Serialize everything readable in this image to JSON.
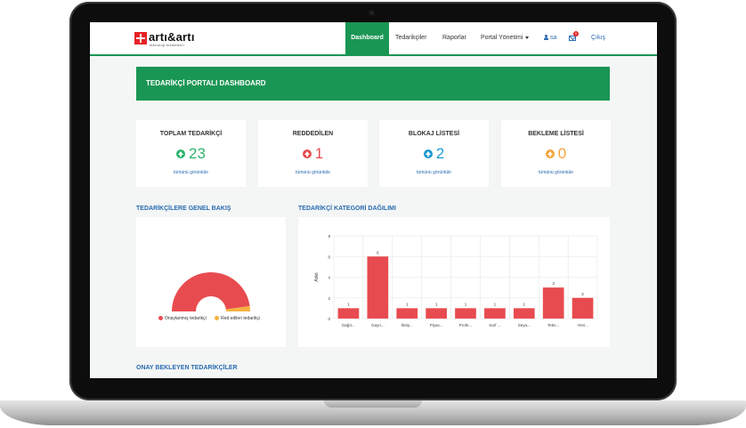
{
  "nav": {
    "brand": "artı&artı",
    "brand_sub": "teknoloji hizmetleri",
    "items": [
      {
        "label": "Dashboard",
        "active": true
      },
      {
        "label": "Tedarikçiler"
      },
      {
        "label": "Raporlar"
      },
      {
        "label": "Portal Yönetimi"
      }
    ],
    "user": "sa",
    "notification_count": "5",
    "logout": "Çıkış"
  },
  "banner": {
    "title": "TEDARİKÇİ PORTALI DASHBOARD"
  },
  "stats": [
    {
      "label": "TOPLAM TEDARİKÇİ",
      "value": "23",
      "link": "tümünü görüntüle",
      "color": "#2db46b"
    },
    {
      "label": "REDDEDİLEN",
      "value": "1",
      "link": "tümünü görüntüle",
      "color": "#e84b4f"
    },
    {
      "label": "BLOKAJ LİSTESİ",
      "value": "2",
      "link": "tümünü görüntüle",
      "color": "#1a9bd0"
    },
    {
      "label": "BEKLEME LİSTESİ",
      "value": "0",
      "link": "tümünü görüntüle",
      "color": "#f4a43a"
    }
  ],
  "overview": {
    "title": "TEDARİKÇİLERE GENEL BAKIŞ",
    "legend": [
      {
        "label": "Onaylanmış tedarikçi",
        "color": "#e84b4f"
      },
      {
        "label": "Red edilen tedarikçi",
        "color": "#f7b13f"
      }
    ]
  },
  "category": {
    "title": "TEDARİKÇİ KATEGORİ DAĞILIMI"
  },
  "pending": {
    "title": "ONAY BEKLEYEN TEDARİKÇİLER"
  },
  "chart_data": [
    {
      "type": "pie",
      "title": "",
      "labels": [
        "Onaylanmış tedarikçi",
        "Red edilen tedarikçi"
      ],
      "values": [
        22,
        1
      ],
      "colors": [
        "#e84b4f",
        "#f7b13f"
      ]
    },
    {
      "type": "bar",
      "title": "",
      "ylabel": "Adet",
      "xlabel": "",
      "ylim": [
        0,
        8
      ],
      "yticks": [
        0,
        2,
        4,
        6,
        8
      ],
      "categories": [
        "Dağıt...",
        "Gayri...",
        "İletiş...",
        "Piyas...",
        "Profe...",
        "Sarf ...",
        "Seya...",
        "Tekn...",
        "Yeni..."
      ],
      "values": [
        1,
        6,
        1,
        1,
        1,
        1,
        1,
        3,
        2
      ],
      "color": "#e84b4f",
      "grid": true
    }
  ]
}
